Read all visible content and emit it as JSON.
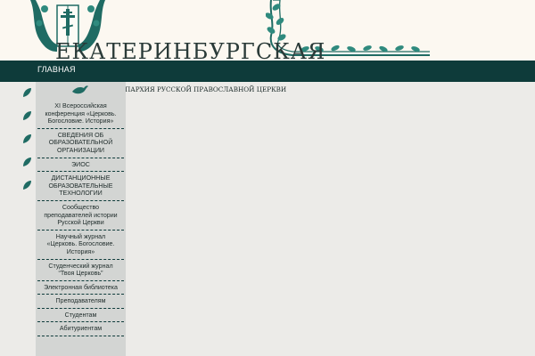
{
  "header": {
    "site_title": "ЕКАТЕРИНБУРГСКАЯ",
    "subtitle": "ПАРХИЯ РУССКОЙ ПРАВОСЛАВНОЙ ЦЕРКВИ"
  },
  "navbar": {
    "home_label": "ГЛАВНАЯ"
  },
  "sidebar": {
    "items": [
      {
        "label": "XI Всероссийская конференция «Церковь. Богословие. История»"
      },
      {
        "label": "СВЕДЕНИЯ ОБ ОБРАЗОВАТЕЛЬНОЙ ОРГАНИЗАЦИИ"
      },
      {
        "label": "ЭИОС"
      },
      {
        "label": "ДИСТАНЦИОННЫЕ ОБРАЗОВАТЕЛЬНЫЕ ТЕХНОЛОГИИ"
      },
      {
        "label": "Сообщество преподавателей истории Русской Церкви"
      },
      {
        "label": "Научный журнал «Церковь. Богословие. История»"
      },
      {
        "label": "Студенческий журнал “Твоя Церковь”"
      },
      {
        "label": "Электронная библиотека"
      },
      {
        "label": "Преподавателям"
      },
      {
        "label": "Студентам"
      },
      {
        "label": "Абитуриентам"
      }
    ]
  },
  "colors": {
    "nav_bg": "#0e3b3a",
    "ornament": "#1f6b63",
    "header_bg": "#fcf8f1",
    "sidebar_bg": "#d3d5d3"
  }
}
